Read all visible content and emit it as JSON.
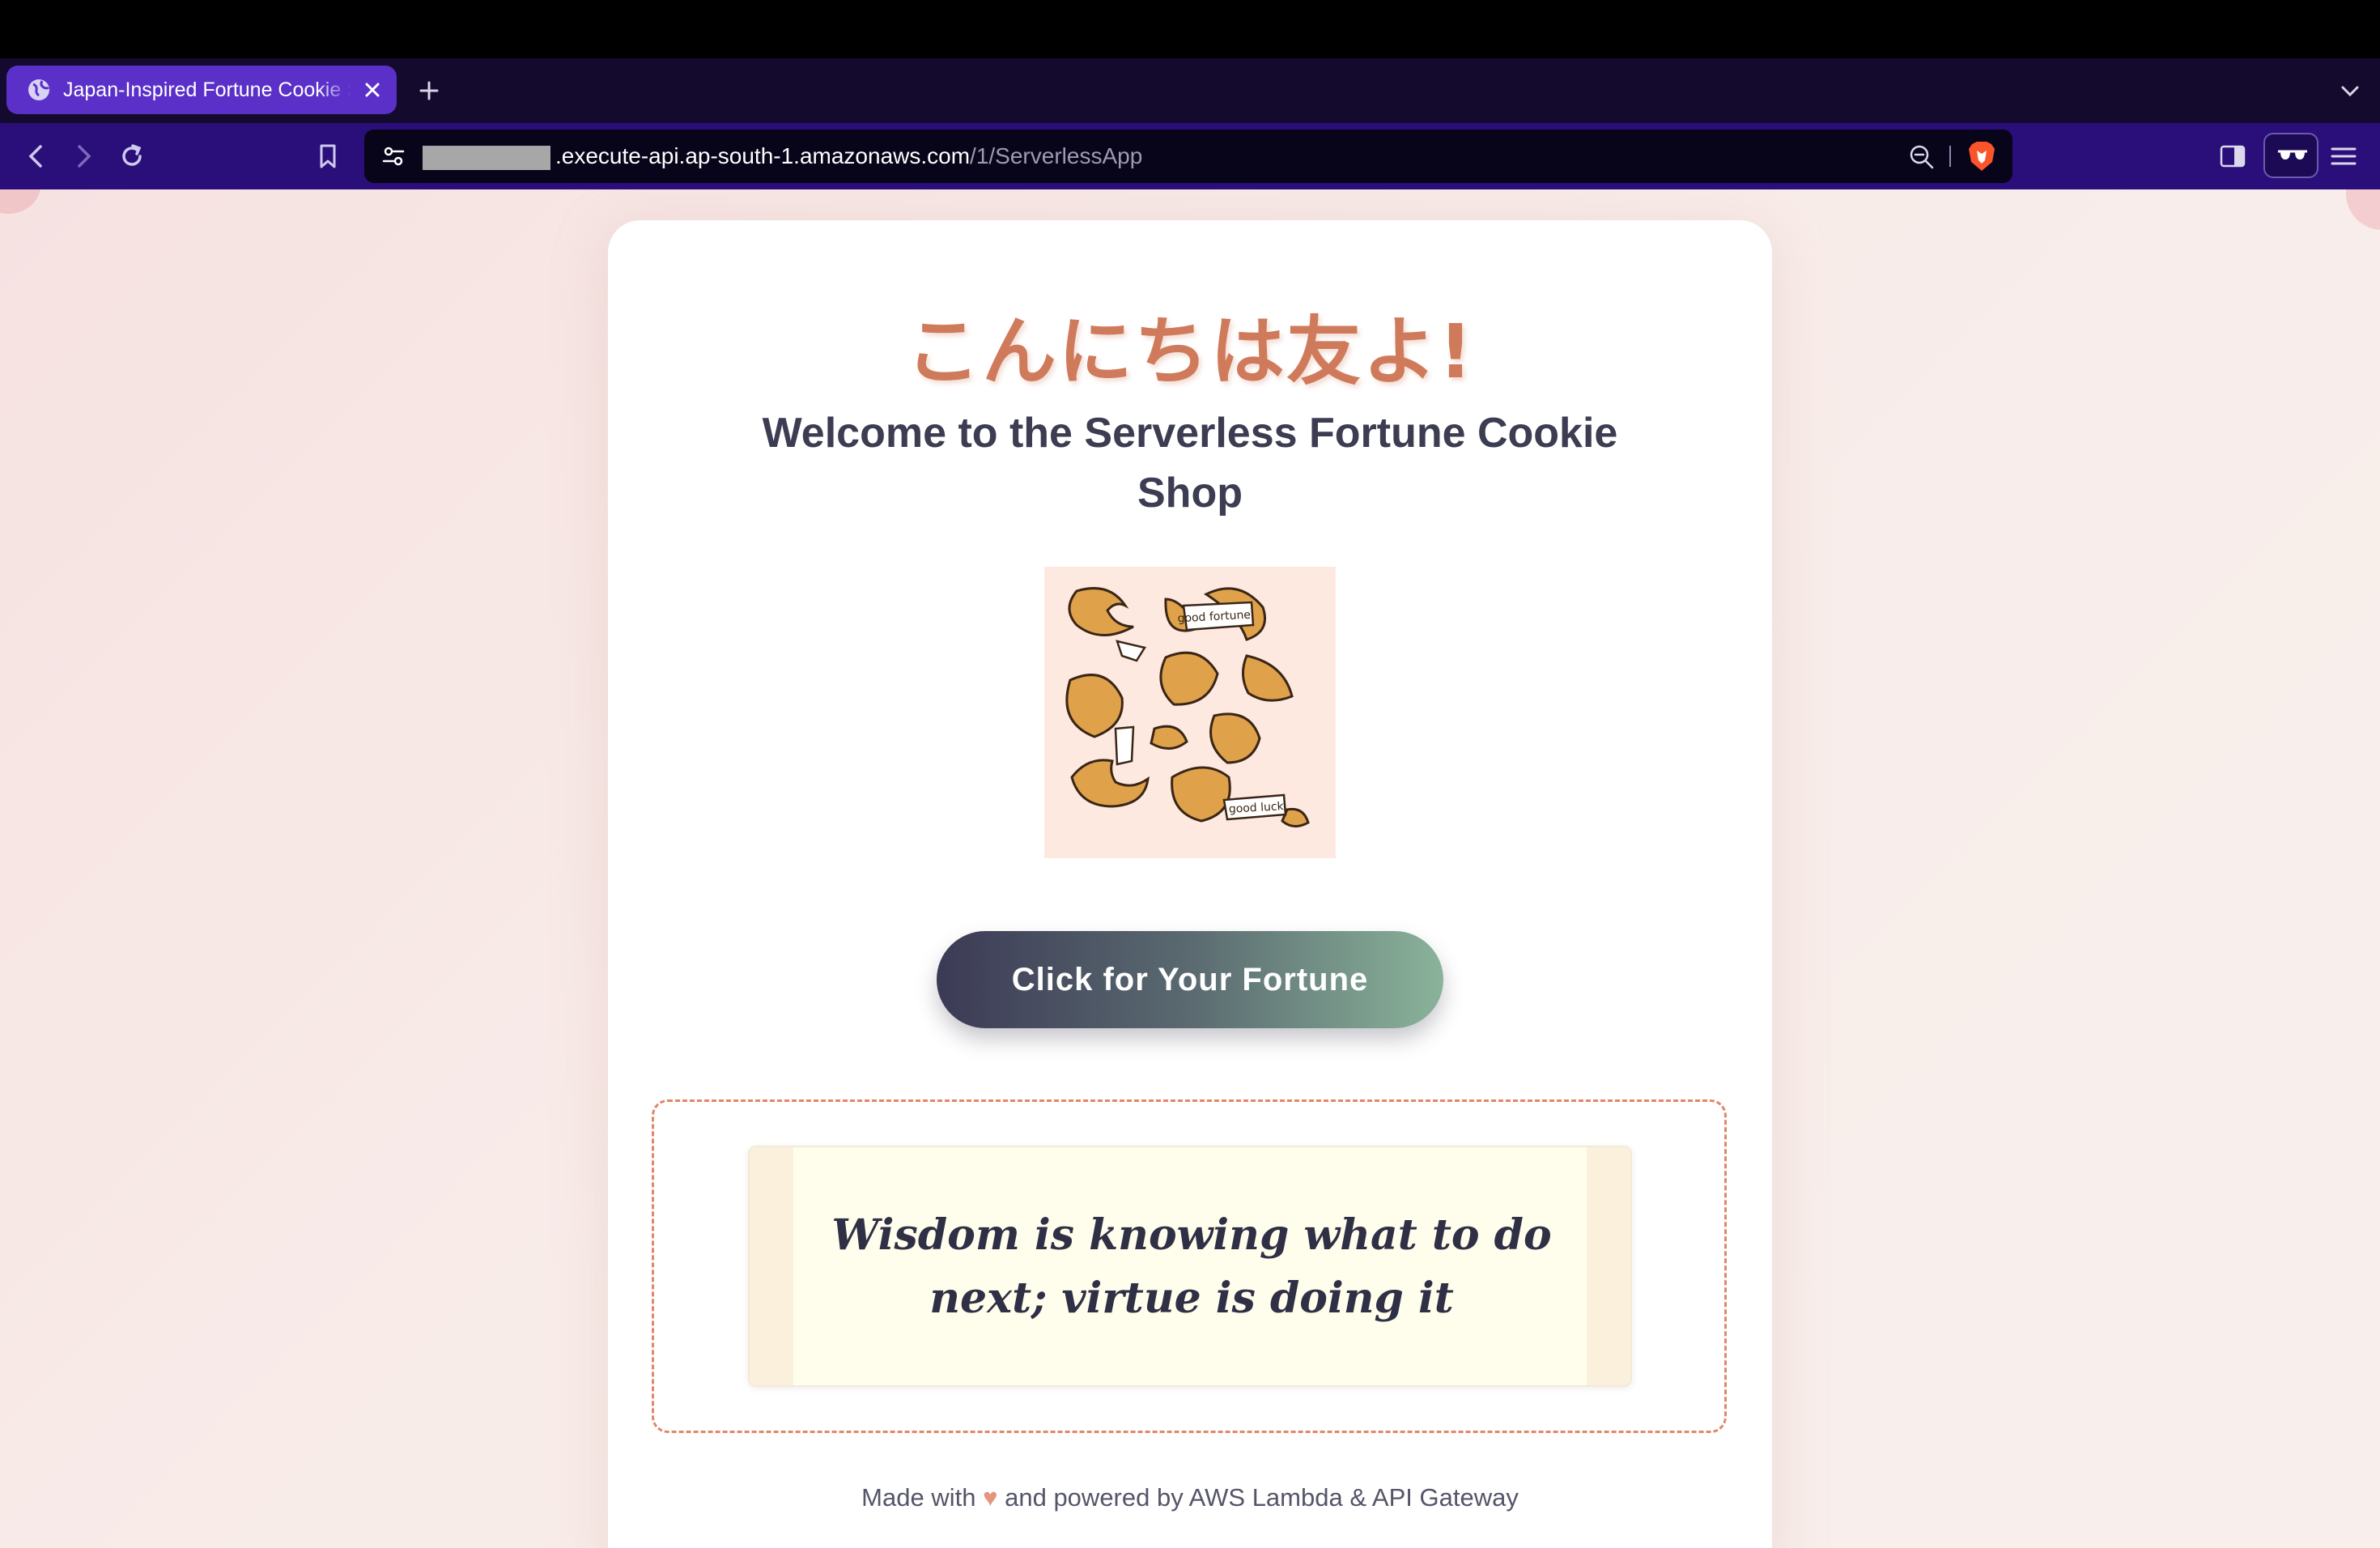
{
  "browser": {
    "tab": {
      "title": "Japan-Inspired Fortune Cookie Shop"
    },
    "url": {
      "host": ".execute-api.ap-south-1.amazonaws.com",
      "path": "/1/ServerlessApp"
    },
    "theme_color": "#2a0e7a",
    "icons": [
      "globe-icon",
      "close-icon",
      "plus-icon",
      "chevron-down-icon",
      "back-icon",
      "forward-icon",
      "reload-icon",
      "bookmark-icon",
      "tune-icon",
      "zoom-icon",
      "brave-shields-icon",
      "sidebar-icon",
      "reader-mode-icon",
      "menu-icon"
    ]
  },
  "page": {
    "greeting": "こんにちは友よ!",
    "welcome": "Welcome to the Serverless Fortune Cookie Shop",
    "cookie_labels": {
      "top": "good fortune",
      "bottom": "good luck"
    },
    "button_label": "Click for Your Fortune",
    "fortune": "Wisdom is knowing what to do next; virtue is doing it",
    "footer": {
      "before": "Made with",
      "heart": "♥",
      "after": "and powered by AWS Lambda & API Gateway"
    },
    "accent_color": "#d07a5c"
  }
}
